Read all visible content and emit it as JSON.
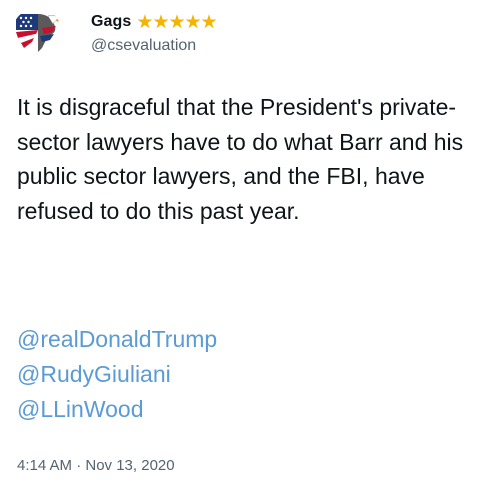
{
  "tweet": {
    "author": {
      "display_name": "Gags",
      "badge": "★★★★★",
      "handle": "@csevaluation",
      "avatar_icon": "american-flag-eagle-icon"
    },
    "text": "It is disgraceful that the President's private-sector lawyers have to do what Barr and his public sector lawyers, and the FBI, have refused to do this past year.",
    "mentions": [
      "@realDonaldTrump",
      "@RudyGiuliani",
      "@LLinWood"
    ],
    "timestamp": "4:14 AM · Nov 13, 2020"
  },
  "colors": {
    "text": "#0f1419",
    "secondary": "#536471",
    "mention": "#5b9bd5",
    "star": "#f4b400"
  }
}
